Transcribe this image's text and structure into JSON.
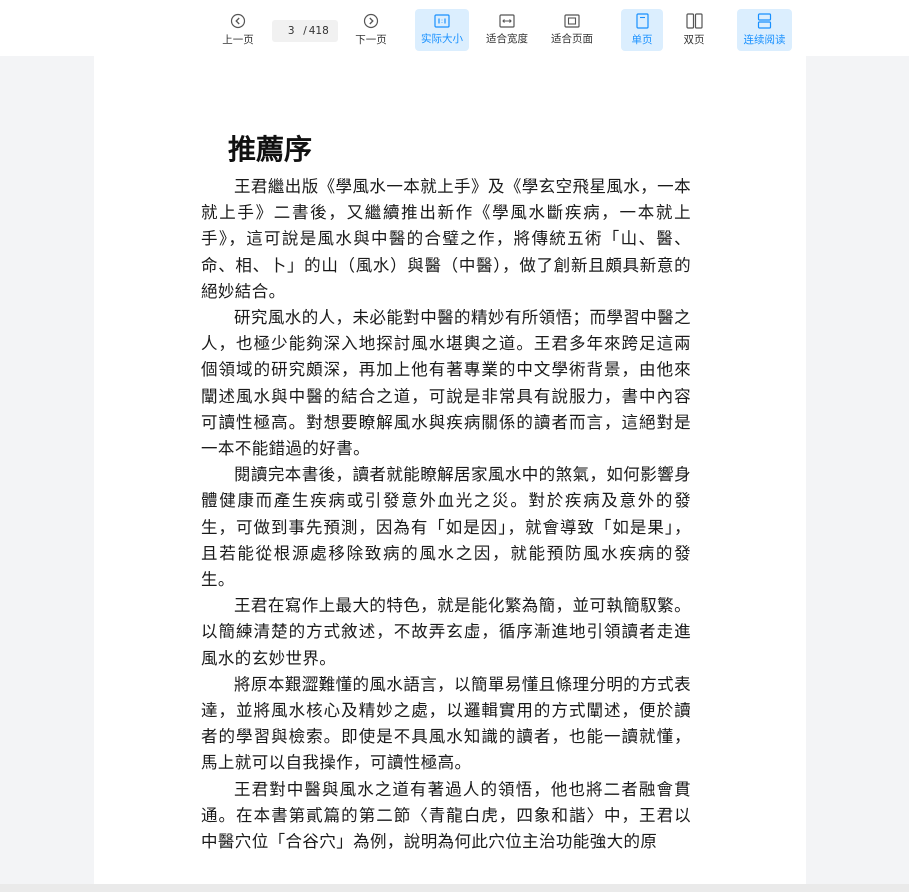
{
  "toolbar": {
    "prev_label": "上一页",
    "current_page": "3",
    "page_separator": "/",
    "total_pages": "418",
    "next_label": "下一页",
    "actual_size_label": "实际大小",
    "fit_width_label": "适合宽度",
    "fit_page_label": "适合页面",
    "single_page_label": "单页",
    "double_page_label": "双页",
    "continuous_label": "连续阅读",
    "accent_color": "#1890ff",
    "active_bg_color": "#dbeefe"
  },
  "document": {
    "title": "推薦序",
    "paragraphs": [
      "王君繼出版《學風水一本就上手》及《學玄空飛星風水，一本就上手》二書後，又繼續推出新作《學風水斷疾病，一本就上手》，這可說是風水與中醫的合璧之作，將傳統五術「山、醫、命、相、卜」的山（風水）與醫（中醫），做了創新且頗具新意的絕妙結合。",
      "研究風水的人，未必能對中醫的精妙有所領悟；而學習中醫之人，也極少能夠深入地探討風水堪輿之道。王君多年來跨足這兩個領域的研究頗深，再加上他有著專業的中文學術背景，由他來闡述風水與中醫的結合之道，可說是非常具有說服力，書中內容可讀性極高。對想要瞭解風水與疾病關係的讀者而言，這絕對是一本不能錯過的好書。",
      "閱讀完本書後，讀者就能瞭解居家風水中的煞氣，如何影響身體健康而產生疾病或引發意外血光之災。對於疾病及意外的發生，可做到事先預測，因為有「如是因」，就會導致「如是果」，且若能從根源處移除致病的風水之因，就能預防風水疾病的發生。",
      "王君在寫作上最大的特色，就是能化繁為簡，並可執簡馭繁。以簡練清楚的方式敘述，不故弄玄虛，循序漸進地引領讀者走進風水的玄妙世界。",
      "將原本艱澀難懂的風水語言，以簡單易懂且條理分明的方式表達，並將風水核心及精妙之處，以邏輯實用的方式闡述，便於讀者的學習與檢索。即使是不具風水知識的讀者，也能一讀就懂，馬上就可以自我操作，可讀性極高。",
      "王君對中醫與風水之道有著過人的領悟，他也將二者融會貫通。在本書第貳篇的第二節〈青龍白虎，四象和諧〉中，王君以中醫穴位「合谷穴」為例，說明為何此穴位主治功能強大的原"
    ]
  }
}
